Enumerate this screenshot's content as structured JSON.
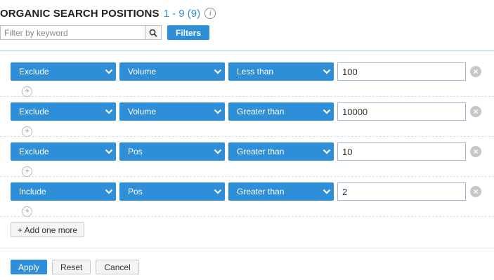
{
  "header": {
    "title": "ORGANIC SEARCH POSITIONS",
    "range": "1 - 9 (9)",
    "info_icon": "info-icon"
  },
  "search": {
    "placeholder": "Filter by keyword",
    "value": "",
    "icon": "search-icon",
    "filters_label": "Filters"
  },
  "rules": [
    {
      "type": "Exclude",
      "field": "Volume",
      "operator": "Less than",
      "value": "100"
    },
    {
      "type": "Exclude",
      "field": "Volume",
      "operator": "Greater than",
      "value": "10000"
    },
    {
      "type": "Exclude",
      "field": "Pos",
      "operator": "Greater than",
      "value": "10"
    },
    {
      "type": "Include",
      "field": "Pos",
      "operator": "Greater than",
      "value": "2"
    }
  ],
  "add_more_label": "+ Add one more",
  "footer": {
    "apply": "Apply",
    "reset": "Reset",
    "cancel": "Cancel"
  },
  "colors": {
    "accent": "#2e8fd8",
    "remove": "#c7c7c7"
  }
}
